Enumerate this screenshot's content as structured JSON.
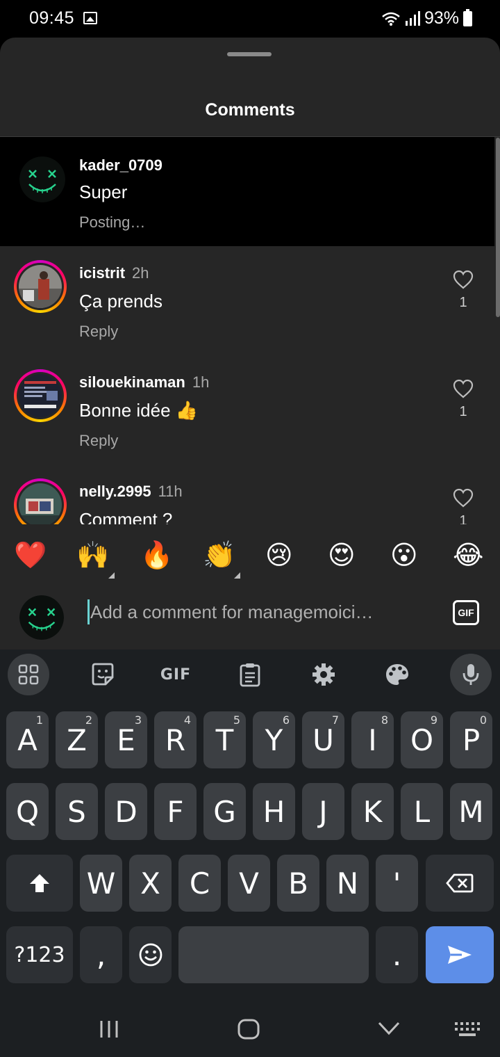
{
  "status_bar": {
    "time": "09:45",
    "battery": "93%",
    "icons": [
      "gallery-icon",
      "wifi-icon",
      "signal-icon",
      "battery-icon"
    ]
  },
  "sheet": {
    "title": "Comments"
  },
  "comments": [
    {
      "username": "kader_0709",
      "time": "",
      "text": "Super",
      "meta": "Posting…",
      "likes": "",
      "pending": true
    },
    {
      "username": "icistrit",
      "time": "2h",
      "text": "Ça prends",
      "meta": "Reply",
      "likes": "1"
    },
    {
      "username": "silouekinaman",
      "time": "1h",
      "text": "Bonne idée 👍",
      "meta": "Reply",
      "likes": "1"
    },
    {
      "username": "nelly.2995",
      "time": "11h",
      "text": "Comment ?",
      "meta": "",
      "likes": "1"
    }
  ],
  "reactions": [
    "❤️",
    "🙌",
    "🔥",
    "👏",
    "😢",
    "😍",
    "😮",
    "😂"
  ],
  "composer": {
    "placeholder": "Add a comment for managemoici…",
    "gif_label": "GIF"
  },
  "keyboard": {
    "toolbar": [
      "apps-grid-icon",
      "sticker-icon",
      "GIF",
      "clipboard-icon",
      "settings-gear-icon",
      "palette-icon",
      "microphone-icon"
    ],
    "row1": [
      {
        "k": "A",
        "s": "1"
      },
      {
        "k": "Z",
        "s": "2"
      },
      {
        "k": "E",
        "s": "3"
      },
      {
        "k": "R",
        "s": "4"
      },
      {
        "k": "T",
        "s": "5"
      },
      {
        "k": "Y",
        "s": "6"
      },
      {
        "k": "U",
        "s": "7"
      },
      {
        "k": "I",
        "s": "8"
      },
      {
        "k": "O",
        "s": "9"
      },
      {
        "k": "P",
        "s": "0"
      }
    ],
    "row2": [
      "Q",
      "S",
      "D",
      "F",
      "G",
      "H",
      "J",
      "K",
      "L",
      "M"
    ],
    "row3": [
      "W",
      "X",
      "C",
      "V",
      "B",
      "N",
      "'"
    ],
    "sym": "?123",
    "comma": ",",
    "period": "."
  },
  "colors": {
    "sheet_bg": "#262626",
    "key_bg": "#3c3f43",
    "send_key": "#5d8ee8",
    "story_ring": "#d300c5"
  }
}
